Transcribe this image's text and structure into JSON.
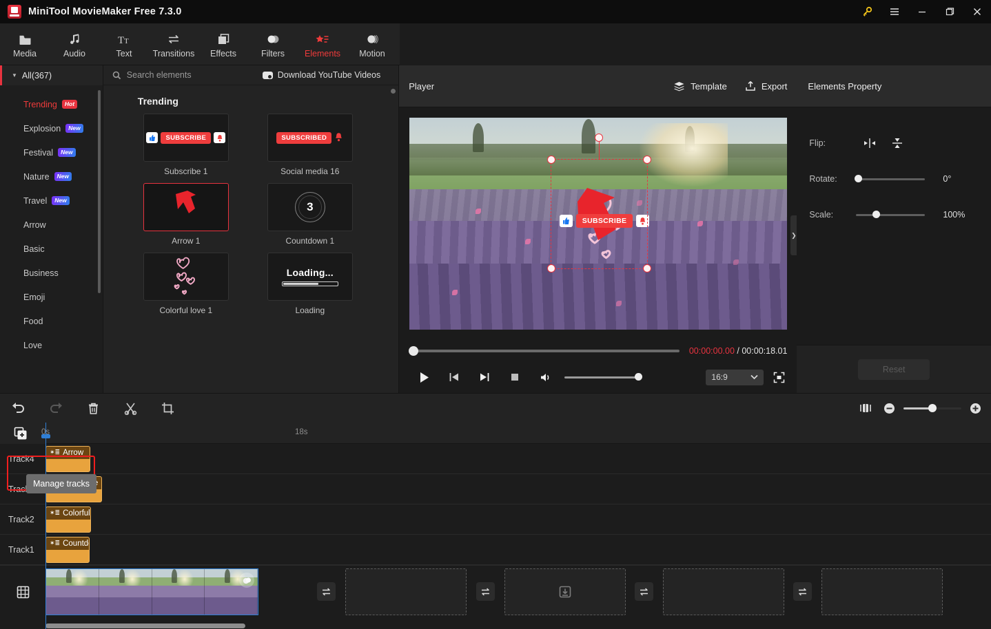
{
  "titlebar": {
    "app_title": "MiniTool MovieMaker Free 7.3.0",
    "logo_name": "minitool-logo",
    "window_buttons": [
      {
        "name": "key-icon",
        "glyph": "key"
      },
      {
        "name": "menu-icon",
        "glyph": "hamburger"
      },
      {
        "name": "minimize-button",
        "glyph": "minimize"
      },
      {
        "name": "maximize-button",
        "glyph": "maximize"
      },
      {
        "name": "close-button",
        "glyph": "close"
      }
    ]
  },
  "toolbar": {
    "items": [
      {
        "label": "Media",
        "icon": "folder-icon",
        "active": false
      },
      {
        "label": "Audio",
        "icon": "music-note-icon",
        "active": false
      },
      {
        "label": "Text",
        "icon": "text-icon",
        "active": false
      },
      {
        "label": "Transitions",
        "icon": "transitions-icon",
        "active": false
      },
      {
        "label": "Effects",
        "icon": "effects-icon",
        "active": false
      },
      {
        "label": "Filters",
        "icon": "filters-icon",
        "active": false
      },
      {
        "label": "Elements",
        "icon": "elements-icon",
        "active": true
      },
      {
        "label": "Motion",
        "icon": "motion-icon",
        "active": false
      }
    ]
  },
  "categories": {
    "all_label": "All(367)",
    "items": [
      {
        "label": "Trending",
        "badge": "Hot",
        "badge_type": "hot",
        "selected": true
      },
      {
        "label": "Explosion",
        "badge": "New",
        "badge_type": "new"
      },
      {
        "label": "Festival",
        "badge": "New",
        "badge_type": "new"
      },
      {
        "label": "Nature",
        "badge": "New",
        "badge_type": "new"
      },
      {
        "label": "Travel",
        "badge": "New",
        "badge_type": "new"
      },
      {
        "label": "Arrow",
        "badge": "",
        "badge_type": ""
      },
      {
        "label": "Basic",
        "badge": "",
        "badge_type": ""
      },
      {
        "label": "Business",
        "badge": "",
        "badge_type": ""
      },
      {
        "label": "Emoji",
        "badge": "",
        "badge_type": ""
      },
      {
        "label": "Food",
        "badge": "",
        "badge_type": ""
      },
      {
        "label": "Love",
        "badge": "",
        "badge_type": ""
      }
    ]
  },
  "browser": {
    "search_placeholder": "Search elements",
    "download_label": "Download YouTube Videos",
    "section_title": "Trending",
    "items": [
      {
        "label": "Subscribe 1",
        "thumb": "subscribe",
        "pill": "SUBSCRIBE",
        "selected": false
      },
      {
        "label": "Social media 16",
        "thumb": "subscribed",
        "pill": "SUBSCRIBED",
        "selected": false
      },
      {
        "label": "Arrow 1",
        "thumb": "arrow",
        "pill": "",
        "selected": true
      },
      {
        "label": "Countdown 1",
        "thumb": "countdown",
        "pill": "3",
        "selected": false
      },
      {
        "label": "Colorful love 1",
        "thumb": "hearts",
        "pill": "",
        "selected": false
      },
      {
        "label": "Loading",
        "thumb": "loading",
        "pill": "Loading...",
        "selected": false
      }
    ]
  },
  "player": {
    "label": "Player",
    "template_label": "Template",
    "export_label": "Export",
    "current_time": "00:00:00.00",
    "time_separator": "/",
    "total_time": "00:00:18.01",
    "aspect_ratio": "16:9",
    "overlay_subscribe": "SUBSCRIBE",
    "accent_color": "#e8333f",
    "controls": [
      {
        "name": "play-button",
        "glyph": "play"
      },
      {
        "name": "previous-frame-button",
        "glyph": "prev"
      },
      {
        "name": "next-frame-button",
        "glyph": "next"
      },
      {
        "name": "stop-button",
        "glyph": "stop"
      },
      {
        "name": "volume-button",
        "glyph": "volume"
      }
    ]
  },
  "properties": {
    "title": "Elements Property",
    "flip_label": "Flip:",
    "rotate_label": "Rotate:",
    "rotate_value": "0°",
    "scale_label": "Scale:",
    "scale_value": "100%",
    "reset_label": "Reset"
  },
  "timeline": {
    "toolbar": [
      {
        "name": "undo-button",
        "glyph": "undo",
        "dim": false
      },
      {
        "name": "redo-button",
        "glyph": "redo",
        "dim": true
      },
      {
        "name": "delete-button",
        "glyph": "trash",
        "dim": false
      },
      {
        "name": "split-button",
        "glyph": "scissors",
        "dim": false
      },
      {
        "name": "crop-button",
        "glyph": "crop",
        "dim": false
      }
    ],
    "ruler_ticks": [
      "0s",
      "18s"
    ],
    "manage_tracks_tooltip": "Manage tracks",
    "zoom_value": 50,
    "tracks": [
      {
        "name": "Track4",
        "clip_label": "Arrow",
        "clip_left": 0,
        "clip_width": 65
      },
      {
        "name": "Track3",
        "clip_label": "Subscribe",
        "clip_left": 0,
        "clip_width": 82
      },
      {
        "name": "Track2",
        "clip_label": "Colorful",
        "clip_left": 0,
        "clip_width": 66
      },
      {
        "name": "Track1",
        "clip_label": "Countdown",
        "clip_left": 0,
        "clip_width": 64
      }
    ]
  }
}
